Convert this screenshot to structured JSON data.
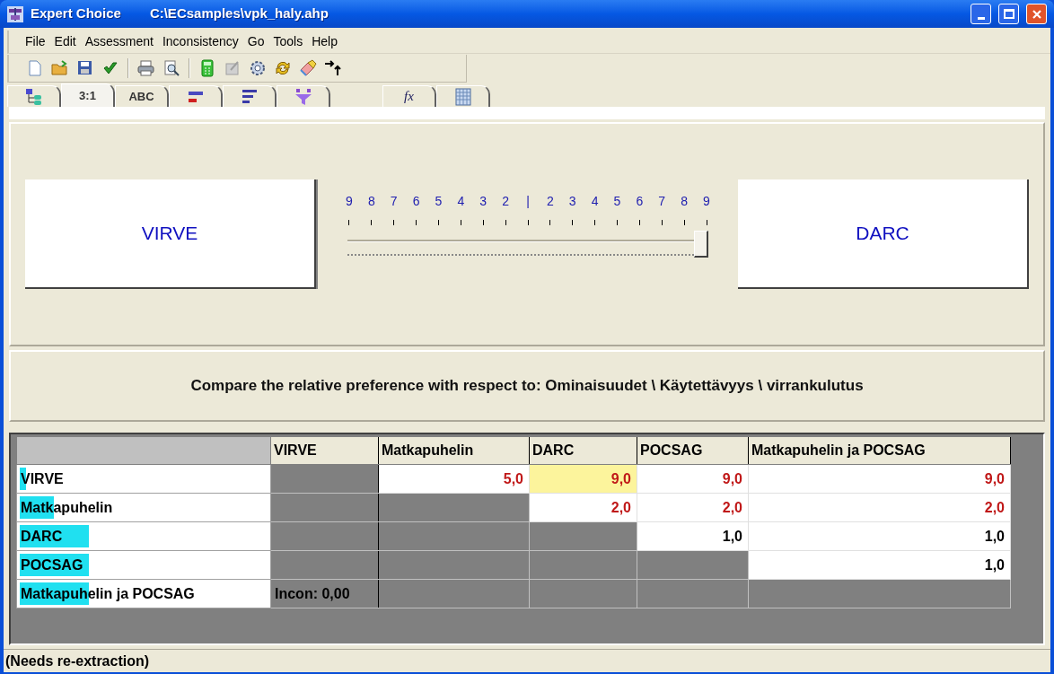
{
  "window": {
    "title": "Expert Choice",
    "file_path": "C:\\ECsamples\\vpk_haly.ahp"
  },
  "menu": [
    "File",
    "Edit",
    "Assessment",
    "Inconsistency",
    "Go",
    "Tools",
    "Help"
  ],
  "tabs": [
    {
      "selected": false
    },
    {
      "label": "3:1",
      "selected": true
    },
    {
      "label": "ABC",
      "selected": false
    },
    {
      "selected": false
    },
    {
      "selected": false
    },
    {
      "selected": false
    },
    {
      "label": "fx",
      "selected": false
    },
    {
      "selected": false
    }
  ],
  "comparison": {
    "left": "VIRVE",
    "right": "DARC",
    "scale": [
      "9",
      "8",
      "7",
      "6",
      "5",
      "4",
      "3",
      "2",
      "|",
      "2",
      "3",
      "4",
      "5",
      "6",
      "7",
      "8",
      "9"
    ],
    "slider": {
      "level": 1
    }
  },
  "prompt": "Compare the relative preference with respect to: Ominaisuudet \\ Käytettävyys  \\ virrankulutus",
  "grid": {
    "columns": [
      "VIRVE",
      "Matkapuhelin",
      "DARC",
      "POCSAG",
      "Matkapuhelin ja POCSAG"
    ],
    "rows": [
      {
        "label": "VIRVE",
        "level": 0.025,
        "cells": [
          {
            "kind": "blank"
          },
          {
            "kind": "value",
            "text": "5,0",
            "inverse": true,
            "selected": false
          },
          {
            "kind": "value",
            "text": "9,0",
            "inverse": true,
            "selected": true
          },
          {
            "kind": "value",
            "text": "9,0",
            "inverse": true,
            "selected": false
          },
          {
            "kind": "value",
            "text": "9,0",
            "inverse": true,
            "selected": false
          }
        ]
      },
      {
        "label": "Matkapuhelin",
        "level": 0.135,
        "cells": [
          {
            "kind": "blank"
          },
          {
            "kind": "blank"
          },
          {
            "kind": "value",
            "text": "2,0",
            "inverse": true,
            "selected": false
          },
          {
            "kind": "value",
            "text": "2,0",
            "inverse": true,
            "selected": false
          },
          {
            "kind": "value",
            "text": "2,0",
            "inverse": true,
            "selected": false
          }
        ]
      },
      {
        "label": "DARC",
        "level": 0.275,
        "cells": [
          {
            "kind": "blank"
          },
          {
            "kind": "blank"
          },
          {
            "kind": "blank"
          },
          {
            "kind": "value",
            "text": "1,0",
            "inverse": false,
            "selected": false
          },
          {
            "kind": "value",
            "text": "1,0",
            "inverse": false,
            "selected": false
          }
        ]
      },
      {
        "label": "POCSAG",
        "level": 0.275,
        "cells": [
          {
            "kind": "blank"
          },
          {
            "kind": "blank"
          },
          {
            "kind": "blank"
          },
          {
            "kind": "blank"
          },
          {
            "kind": "value",
            "text": "1,0",
            "inverse": false,
            "selected": false
          }
        ]
      },
      {
        "label": "Matkapuhelin ja POCSAG",
        "level": 0.275,
        "cells": [
          {
            "kind": "note",
            "text": "Incon: 0,00"
          },
          {
            "kind": "blank"
          },
          {
            "kind": "blank"
          },
          {
            "kind": "blank"
          },
          {
            "kind": "blank"
          }
        ]
      }
    ]
  },
  "status_bar": "(Needs re-extraction)"
}
